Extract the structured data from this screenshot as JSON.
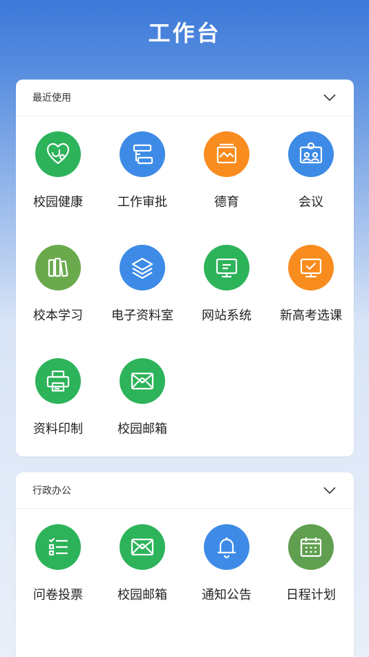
{
  "header": {
    "title": "工作台"
  },
  "sections": [
    {
      "title": "最近使用",
      "items": [
        {
          "label": "校园健康",
          "icon": "heart-health-icon",
          "color": "#2db35a"
        },
        {
          "label": "工作审批",
          "icon": "approval-flow-icon",
          "color": "#3d8be6"
        },
        {
          "label": "德育",
          "icon": "moral-chart-icon",
          "color": "#f98c1e"
        },
        {
          "label": "会议",
          "icon": "meeting-icon",
          "color": "#3d8be6"
        },
        {
          "label": "校本学习",
          "icon": "books-icon",
          "color": "#6aaa4c"
        },
        {
          "label": "电子资料室",
          "icon": "layers-icon",
          "color": "#3d8be6"
        },
        {
          "label": "网站系统",
          "icon": "monitor-icon",
          "color": "#2db35a"
        },
        {
          "label": "新高考选课",
          "icon": "course-select-icon",
          "color": "#f98c1e"
        },
        {
          "label": "资料印制",
          "icon": "printer-icon",
          "color": "#2db35a"
        },
        {
          "label": "校园邮箱",
          "icon": "mail-icon",
          "color": "#2db35a"
        }
      ]
    },
    {
      "title": "行政办公",
      "items": [
        {
          "label": "问卷投票",
          "icon": "survey-list-icon",
          "color": "#2db35a"
        },
        {
          "label": "校园邮箱",
          "icon": "mail-icon",
          "color": "#2db35a"
        },
        {
          "label": "通知公告",
          "icon": "bell-icon",
          "color": "#3d8be6"
        },
        {
          "label": "日程计划",
          "icon": "calendar-icon",
          "color": "#5f9f4f"
        }
      ]
    }
  ]
}
